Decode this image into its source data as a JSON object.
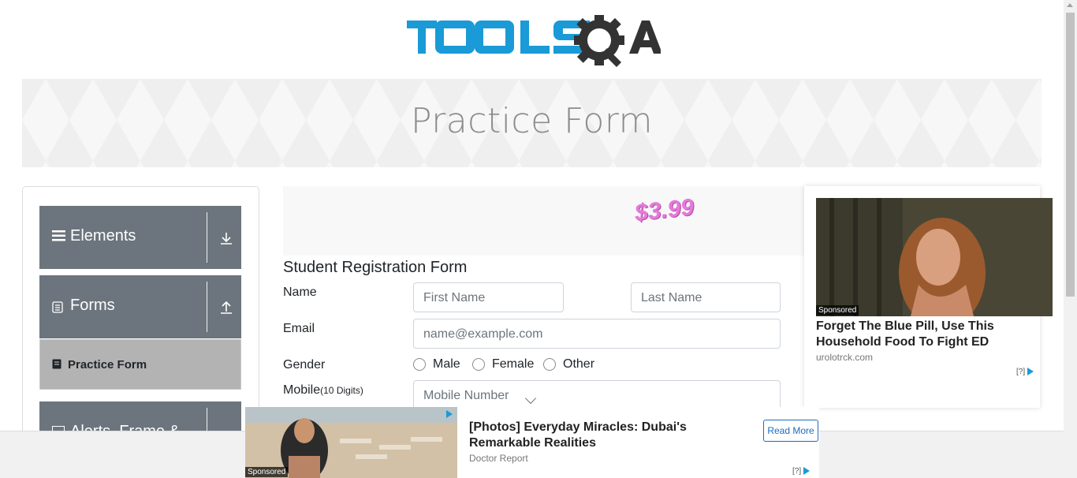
{
  "header": {
    "logo_text": "TOOLSQA",
    "banner_title": "Practice Form"
  },
  "sidebar": {
    "groups": [
      {
        "label": "Elements"
      },
      {
        "label": "Forms"
      },
      {
        "label": "Alerts, Frame & Windows"
      }
    ],
    "active_item": {
      "label": "Practice Form"
    }
  },
  "ad_top": {
    "price": "$3.99"
  },
  "form": {
    "title": "Student Registration Form",
    "name_label": "Name",
    "first_name_placeholder": "First Name",
    "last_name_placeholder": "Last Name",
    "email_label": "Email",
    "email_placeholder": "name@example.com",
    "gender_label": "Gender",
    "gender_options": [
      "Male",
      "Female",
      "Other"
    ],
    "mobile_label": "Mobile",
    "mobile_hint": "(10 Digits)",
    "mobile_placeholder": "Mobile Number"
  },
  "ad_right": {
    "sponsored": "Sponsored",
    "headline": "Forget The Blue Pill, Use This Household Food To Fight ED",
    "domain": "urolotrck.com",
    "adchoice": "[?]"
  },
  "ad_bottom": {
    "sponsored": "Sponsored",
    "headline": "[Photos] Everyday Miracles: Dubai's Remarkable Realities",
    "source": "Doctor Report",
    "read_more": "Read More",
    "adchoice": "[?]"
  },
  "colors": {
    "brand_blue": "#1a9ad6",
    "brand_dark": "#333333",
    "sidebar_group_bg": "#6c757d",
    "sidebar_active_bg": "#b3b3b3"
  }
}
